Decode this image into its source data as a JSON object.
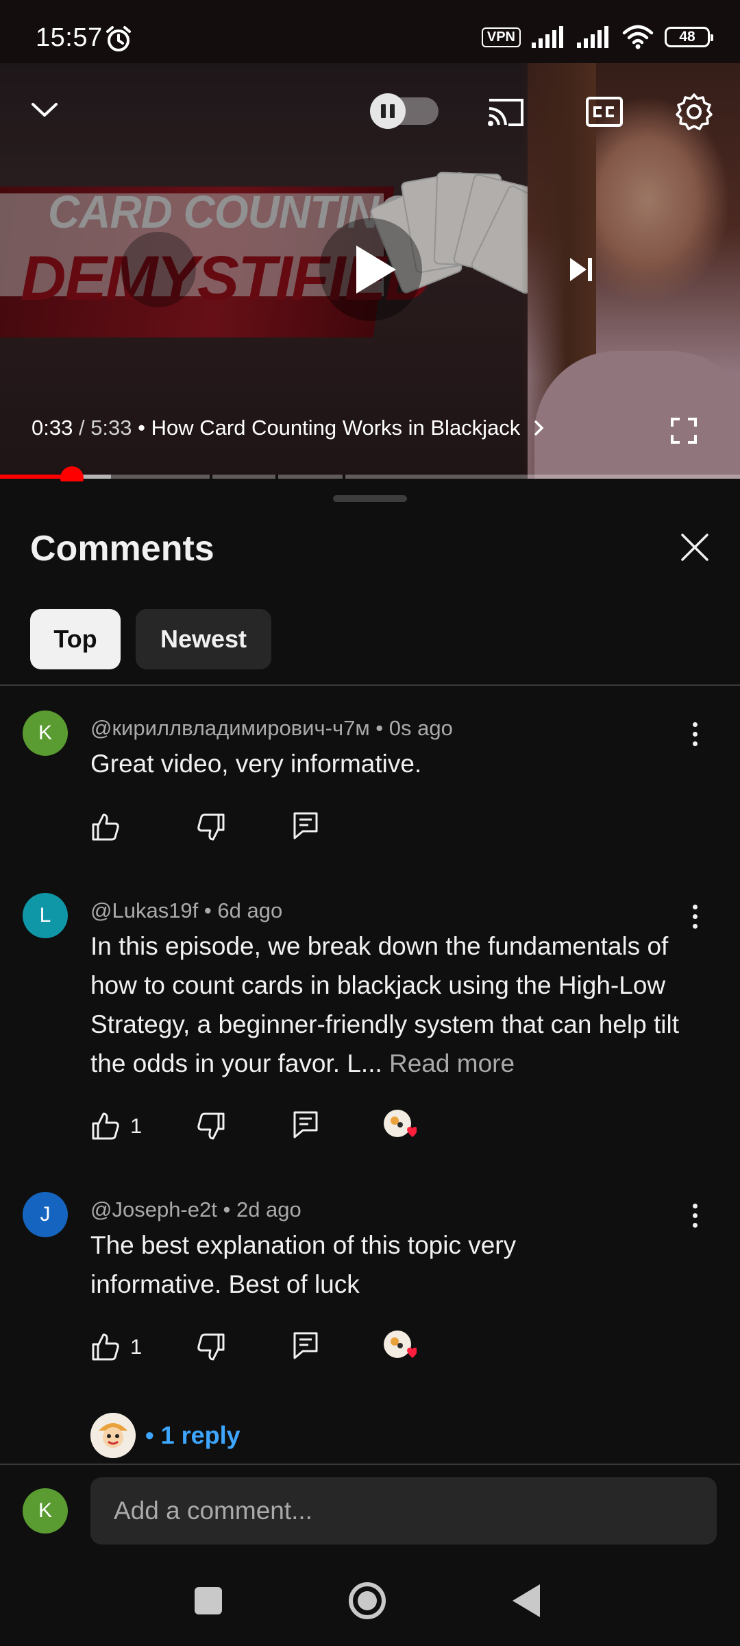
{
  "status_bar": {
    "time": "15:57",
    "vpn": "VPN",
    "battery": "48",
    "icons": [
      "alarm-icon",
      "signal-icon",
      "signal-icon",
      "wifi-icon",
      "battery-icon"
    ]
  },
  "player": {
    "thumbnail": {
      "line1": "CARD COUNTING",
      "line2": "DEMYSTIFIED"
    },
    "current_time": "0:33",
    "separator": " / ",
    "duration": "5:33",
    "dot": " • ",
    "chapter_title": "How Card Counting Works in Blackjack",
    "progress_fraction": 0.1,
    "controls": [
      "collapse-icon",
      "autoplay-toggle",
      "cast-icon",
      "captions-icon",
      "settings-icon",
      "play-icon",
      "next-icon",
      "fullscreen-icon"
    ]
  },
  "comments_sheet": {
    "title": "Comments",
    "filters": {
      "top": "Top",
      "newest": "Newest"
    },
    "comments": [
      {
        "avatar_letter": "K",
        "avatar_color": "#5a9c31",
        "author": "@кириллвладимирович-ч7м",
        "time": "0s ago",
        "text": "Great video, very informative.",
        "likes": "",
        "creator_heart": false
      },
      {
        "avatar_letter": "L",
        "avatar_color": "#0f97a8",
        "author": "@Lukas19f",
        "time": "6d ago",
        "text": "In this episode, we break down the fundamentals of how to count cards in blackjack using the High-Low Strategy, a beginner-friendly system that can help tilt the odds in your favor. L...",
        "read_more": "Read more",
        "likes": "1",
        "creator_heart": true
      },
      {
        "avatar_letter": "J",
        "avatar_color": "#1565c0",
        "author": "@Joseph-e2t",
        "time": "2d ago",
        "text": "The best explanation of this topic very informative. Best of luck",
        "likes": "1",
        "creator_heart": true
      }
    ],
    "reply_link": "• 1 reply",
    "add_comment": {
      "avatar_letter": "K",
      "avatar_color": "#5a9c31",
      "placeholder": "Add a comment..."
    }
  },
  "nav_bar": {
    "buttons": [
      "recents-button",
      "home-button",
      "back-button"
    ]
  },
  "colors": {
    "background": "#0f0f0f",
    "accent_red": "#ff0000",
    "link_blue": "#3ea6ff",
    "secondary_text": "#aaaaaa"
  }
}
